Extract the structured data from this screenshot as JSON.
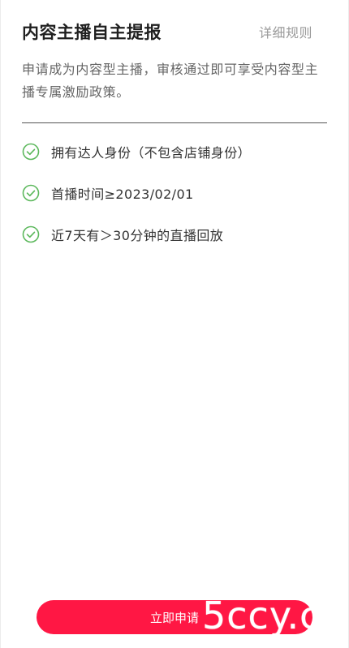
{
  "header": {
    "title": "内容主播自主提报",
    "rules_link": "详细规则"
  },
  "description": "申请成为内容型主播，审核通过即可享受内容型主播专属激励政策。",
  "requirements": [
    {
      "icon": "check-circle-icon",
      "text": "拥有达人身份（不包含店铺身份）"
    },
    {
      "icon": "check-circle-icon",
      "text": "首播时间≥2023/02/01"
    },
    {
      "icon": "check-circle-icon",
      "text": "近7天有＞30分钟的直播回放"
    }
  ],
  "footer": {
    "apply_label": "立即申请"
  },
  "watermark": "5ccy.c",
  "colors": {
    "accent": "#ff1744",
    "check": "#5cb85c",
    "title": "#1f1f1f",
    "muted": "#9a9a9a"
  }
}
